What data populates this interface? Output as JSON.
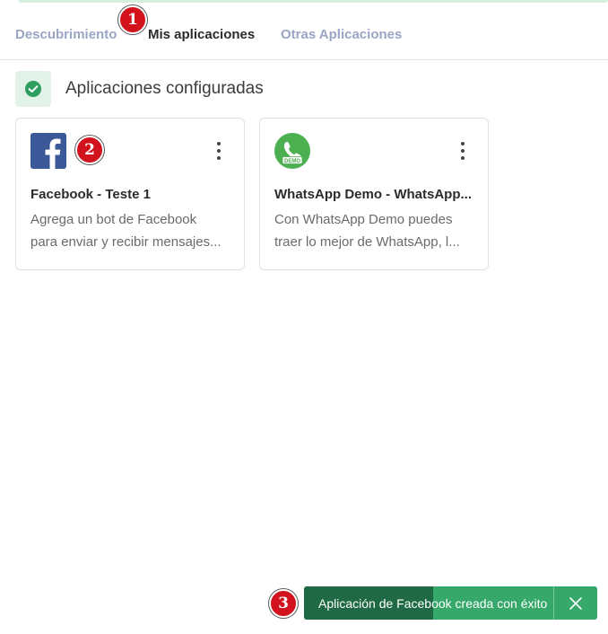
{
  "tabs": {
    "discovery": "Descubrimiento",
    "my_apps": "Mis aplicaciones",
    "other_apps": "Otras Aplicaciones",
    "active": "Mis aplicaciones"
  },
  "markers": {
    "m1": "1",
    "m2": "2",
    "m3": "3"
  },
  "section": {
    "title": "Aplicaciones configuradas",
    "icon": "check-circle-icon"
  },
  "cards": [
    {
      "icon": "facebook-logo",
      "title": "Facebook - Teste 1",
      "desc_line1": "Agrega un bot de Facebook",
      "desc_line2": "para enviar y recibir mensajes..."
    },
    {
      "icon": "whatsapp-demo-logo",
      "logo_badge": "DEMO",
      "title": "WhatsApp Demo - WhatsApp...",
      "desc_line1": "Con WhatsApp Demo puedes",
      "desc_line2": "traer lo mejor de WhatsApp, l..."
    }
  ],
  "toast": {
    "message": "Aplicación de Facebook creada con éxito",
    "progress": 0.44,
    "close_icon": "close-icon"
  },
  "colors": {
    "facebook_blue": "#3b5998",
    "whatsapp_green": "#4caf50",
    "success_green": "#35a86a",
    "success_dark": "#1f6a44",
    "tab_inactive": "#9aa6c4",
    "marker_red": "#d2121c"
  }
}
